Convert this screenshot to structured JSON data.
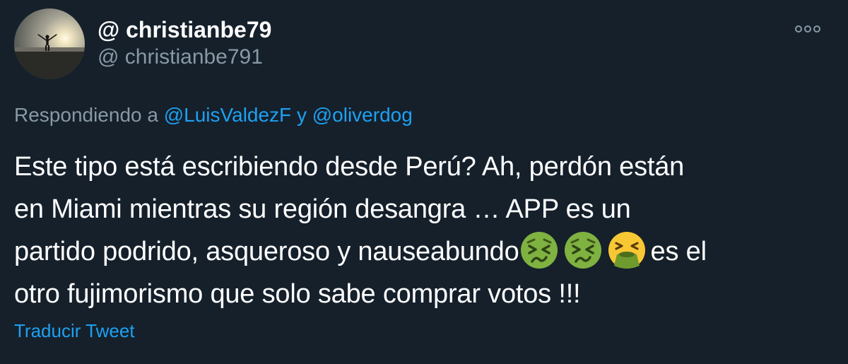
{
  "author": {
    "display_name": "@ christianbe79",
    "handle": "@ christianbe791",
    "avatar_icon": "avatar-sunset-silhouette"
  },
  "menu": {
    "icon": "more-horizontal-icon"
  },
  "reply_context": {
    "prefix": "Respondiendo a",
    "mention_1": "@LuisValdezF",
    "conjunction": "y",
    "mention_2": "@oliverdog"
  },
  "tweet": {
    "line_1": "Este tipo está escribiendo desde Perú? Ah, perdón están",
    "line_2": "en Miami mientras su región desangra … APP es un",
    "line_3_text": "partido podrido, asqueroso y nauseabundo",
    "emojis": [
      "nauseated-face-icon",
      "nauseated-face-icon",
      "vomiting-face-icon"
    ],
    "line_3_suffix": "es el",
    "line_4": "otro fujimorismo que solo sabe comprar votos !!!"
  },
  "actions": {
    "translate_label": "Traducir Tweet"
  },
  "colors": {
    "background": "#15202b",
    "text_primary": "#ffffff",
    "text_secondary": "#8899a6",
    "link": "#1da1f2",
    "nauseated_green": "#7fb241",
    "emoji_yellow": "#f8c834"
  }
}
